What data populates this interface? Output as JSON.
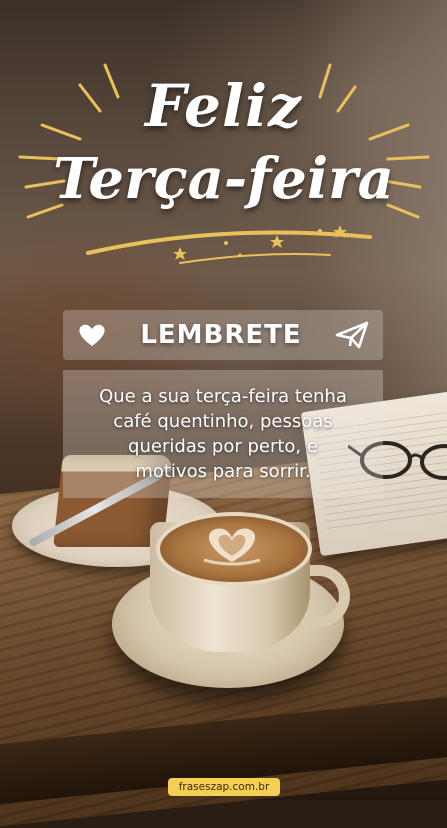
{
  "title": {
    "line1": "Feliz",
    "line2": "Terça-feira"
  },
  "banner": {
    "label": "LEMBRETE",
    "left_icon": "heart-icon",
    "right_icon": "paper-plane-icon"
  },
  "message": {
    "line1": "Que a sua terça-feira tenha",
    "line2": "café quentinho, pessoas",
    "line3": "queridas por perto, e",
    "line4": "motivos para sorrir."
  },
  "footer": {
    "site": "fraseszap.com.br"
  },
  "colors": {
    "accent_gold": "#e9c15a",
    "badge_yellow": "#f4cf53",
    "title_white": "#ffffff"
  }
}
